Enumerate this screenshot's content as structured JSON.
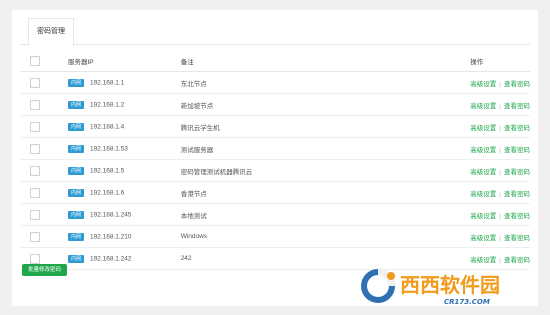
{
  "tabs": [
    "密码管理"
  ],
  "table": {
    "headers": {
      "ip": "服务器IP",
      "note": "备注",
      "ops": "操作"
    },
    "badge": "内网",
    "op_advanced": "高级设置",
    "op_separator": "|",
    "op_view": "查看密码",
    "rows": [
      {
        "ip": "192.168.1.1",
        "note": "东北节点"
      },
      {
        "ip": "192.168.1.2",
        "note": "新加坡节点"
      },
      {
        "ip": "192.168.1.4",
        "note": "腾讯云学生机"
      },
      {
        "ip": "192.168.1.53",
        "note": "测试服务器"
      },
      {
        "ip": "192.168.1.5",
        "note": "密码管理测试机器腾讯云"
      },
      {
        "ip": "192.168.1.6",
        "note": "香港节点"
      },
      {
        "ip": "192.168.1.245",
        "note": "本地测试"
      },
      {
        "ip": "192.168.1.210",
        "note": "Windows"
      },
      {
        "ip": "192.168.1.242",
        "note": "242"
      }
    ]
  },
  "batch_button": "批量修改密码",
  "watermark": {
    "text": "西西软件园",
    "sub": "CR173.COM"
  },
  "colors": {
    "accent": "#1fa64b",
    "badge": "#2f9bd6"
  }
}
